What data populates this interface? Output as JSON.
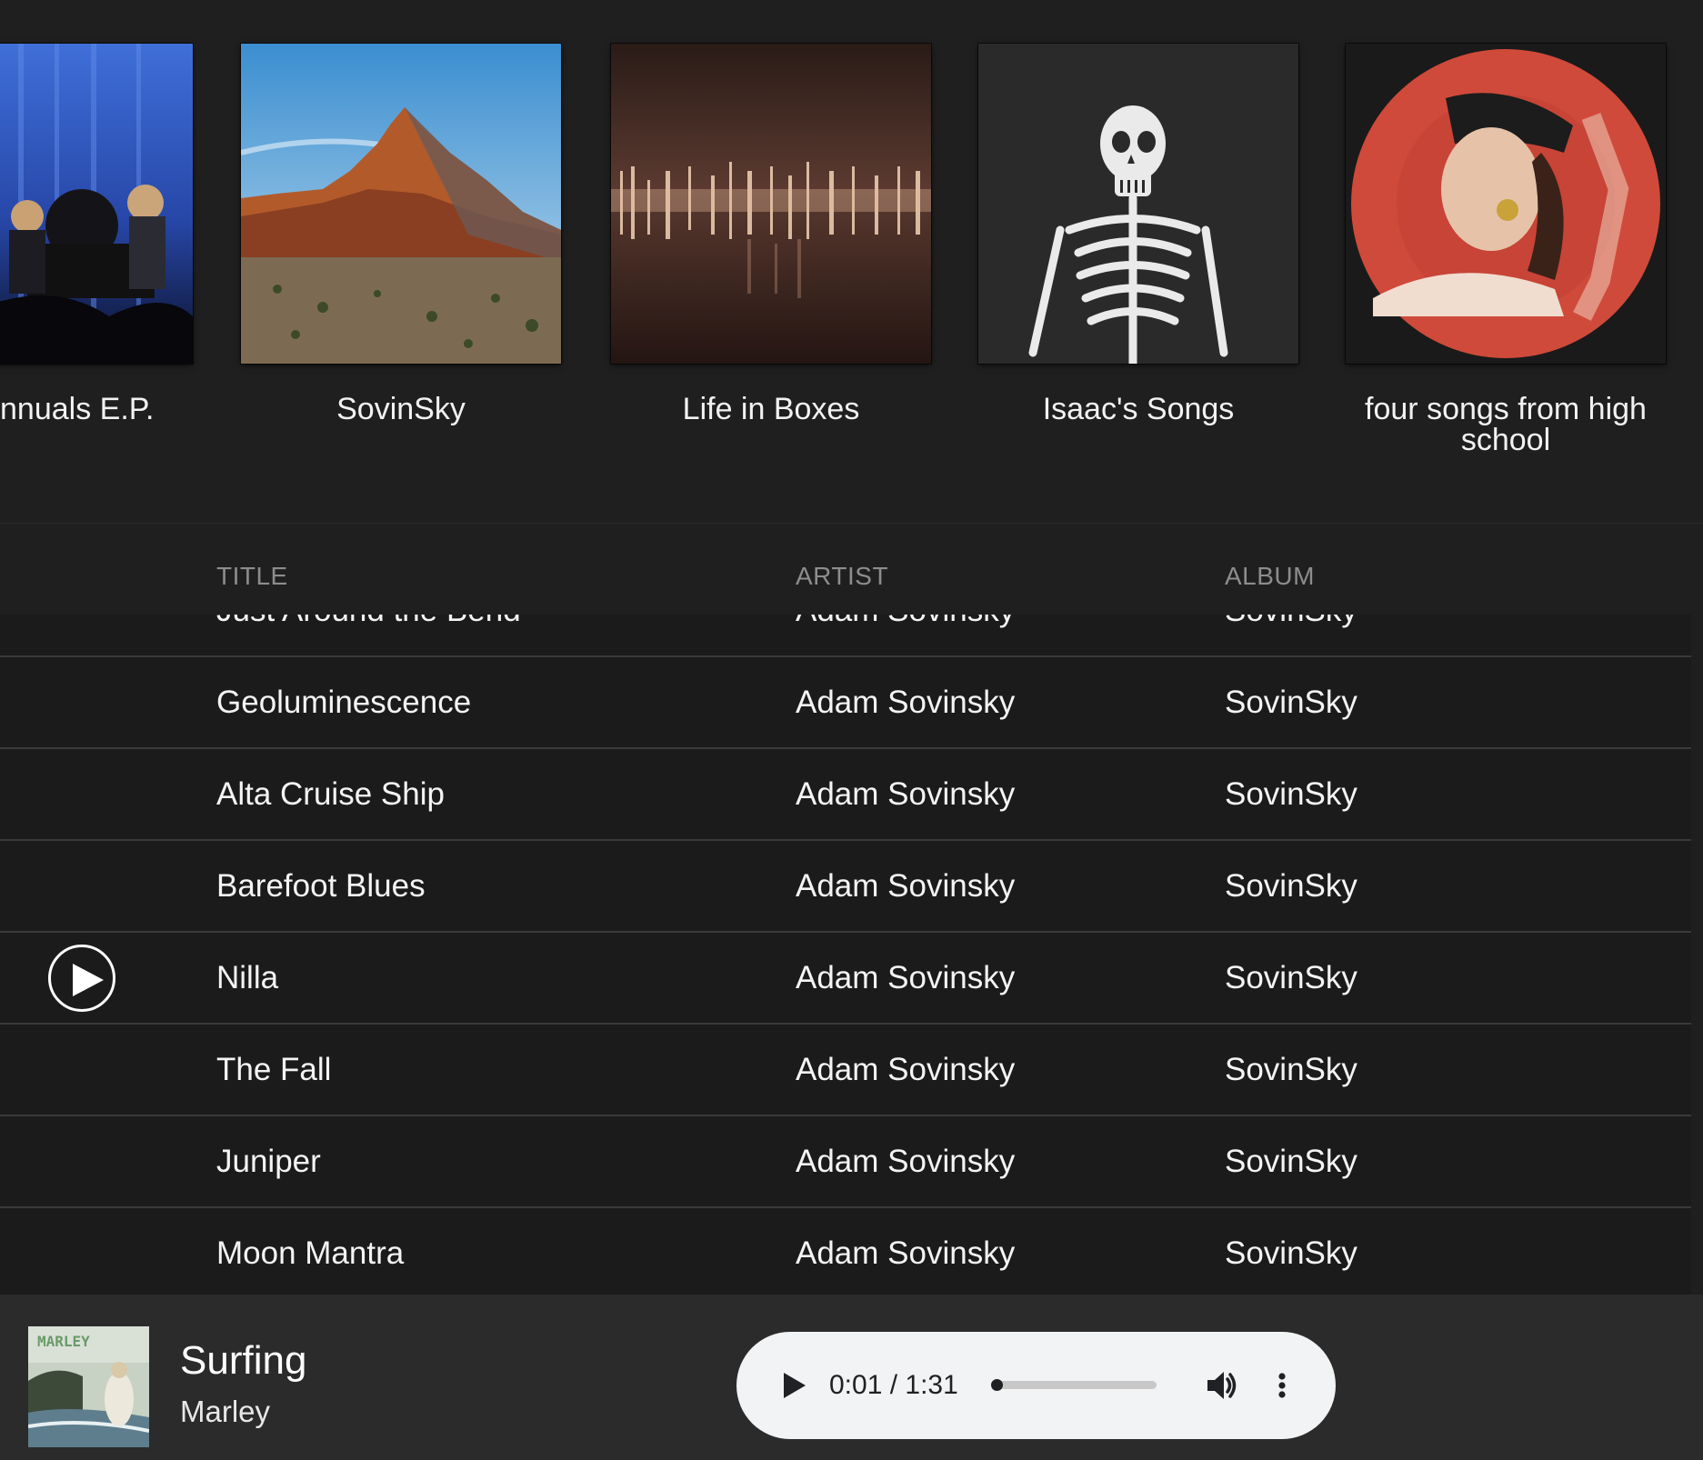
{
  "albums": [
    {
      "title": "nnuals E.P.",
      "art": "band-on-stage"
    },
    {
      "title": "SovinSky",
      "art": "desert-mountain"
    },
    {
      "title": "Life in Boxes",
      "art": "blurred-lights"
    },
    {
      "title": "Isaac's Songs",
      "art": "skeleton"
    },
    {
      "title": "four songs from high school",
      "art": "face-on-red-record"
    }
  ],
  "table": {
    "headers": {
      "title": "TITLE",
      "artist": "ARTIST",
      "album": "ALBUM"
    },
    "rows": [
      {
        "title": "Just Around the Bend",
        "artist": "Adam Sovinsky",
        "album": "SovinSky"
      },
      {
        "title": "Geoluminescence",
        "artist": "Adam Sovinsky",
        "album": "SovinSky"
      },
      {
        "title": "Alta Cruise Ship",
        "artist": "Adam Sovinsky",
        "album": "SovinSky"
      },
      {
        "title": "Barefoot Blues",
        "artist": "Adam Sovinsky",
        "album": "SovinSky"
      },
      {
        "title": "Nilla",
        "artist": "Adam Sovinsky",
        "album": "SovinSky",
        "hovered": true
      },
      {
        "title": "The Fall",
        "artist": "Adam Sovinsky",
        "album": "SovinSky"
      },
      {
        "title": "Juniper",
        "artist": "Adam Sovinsky",
        "album": "SovinSky"
      },
      {
        "title": "Moon Mantra",
        "artist": "Adam Sovinsky",
        "album": "SovinSky"
      }
    ]
  },
  "now_playing": {
    "title": "Surfing",
    "artist": "Marley",
    "art_label": "MARLEY",
    "time": "0:01 / 1:31",
    "progress": 0.011,
    "icons": {
      "play": "play-icon",
      "volume": "volume-icon",
      "more": "more-vert-icon"
    }
  },
  "colors": {
    "background": "#1f1f1f",
    "row_background": "#1b1b1b",
    "player_bar": "#2b2b2b",
    "audio_control": "#f1f3f4"
  }
}
